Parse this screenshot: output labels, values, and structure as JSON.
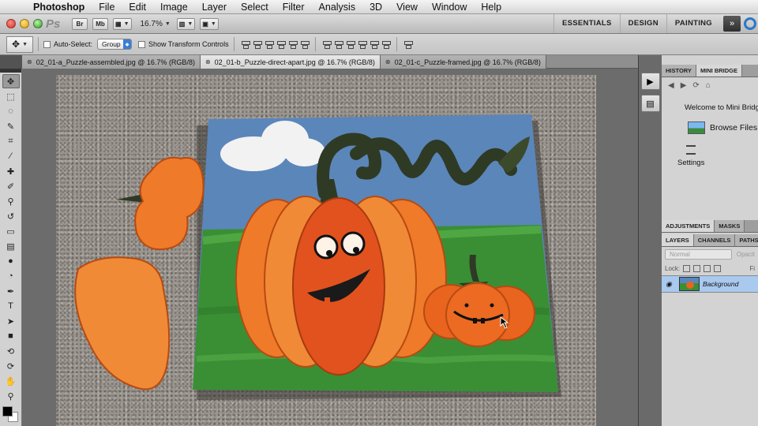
{
  "menubar": {
    "app_name": "Photoshop",
    "items": [
      "File",
      "Edit",
      "Image",
      "Layer",
      "Select",
      "Filter",
      "Analysis",
      "3D",
      "View",
      "Window",
      "Help"
    ]
  },
  "appbar": {
    "ps_logo": "Ps",
    "bridge_btn": "Br",
    "minibridge_btn": "Mb",
    "zoom": "16.7%",
    "workspaces": [
      "ESSENTIALS",
      "DESIGN",
      "PAINTING"
    ],
    "more_label": "»"
  },
  "options": {
    "auto_select_label": "Auto-Select:",
    "auto_select_value": "Group",
    "show_transform_label": "Show Transform Controls"
  },
  "tabs": [
    {
      "label": "02_01-a_Puzzle-assembled.jpg @ 16.7% (RGB/8)",
      "active": false
    },
    {
      "label": "02_01-b_Puzzle-direct-apart.jpg @ 16.7% (RGB/8)",
      "active": true
    },
    {
      "label": "02_01-c_Puzzle-framed.jpg @ 16.7% (RGB/8)",
      "active": false
    }
  ],
  "tools": [
    {
      "name": "move-tool-icon",
      "glyph": "✥",
      "active": true
    },
    {
      "name": "marquee-tool-icon",
      "glyph": "⬚"
    },
    {
      "name": "lasso-tool-icon",
      "glyph": "◌"
    },
    {
      "name": "quick-select-tool-icon",
      "glyph": "✎"
    },
    {
      "name": "crop-tool-icon",
      "glyph": "⌗"
    },
    {
      "name": "eyedropper-tool-icon",
      "glyph": "⁄"
    },
    {
      "name": "healing-brush-tool-icon",
      "glyph": "✚"
    },
    {
      "name": "brush-tool-icon",
      "glyph": "✐"
    },
    {
      "name": "clone-stamp-tool-icon",
      "glyph": "⚲"
    },
    {
      "name": "history-brush-tool-icon",
      "glyph": "↺"
    },
    {
      "name": "eraser-tool-icon",
      "glyph": "▭"
    },
    {
      "name": "gradient-tool-icon",
      "glyph": "▤"
    },
    {
      "name": "blur-tool-icon",
      "glyph": "●"
    },
    {
      "name": "dodge-tool-icon",
      "glyph": "◔"
    },
    {
      "name": "pen-tool-icon",
      "glyph": "✒"
    },
    {
      "name": "type-tool-icon",
      "glyph": "T"
    },
    {
      "name": "path-selection-tool-icon",
      "glyph": "➤"
    },
    {
      "name": "shape-tool-icon",
      "glyph": "■"
    },
    {
      "name": "3d-rotate-tool-icon",
      "glyph": "⟲"
    },
    {
      "name": "3d-orbit-tool-icon",
      "glyph": "⟳"
    },
    {
      "name": "hand-tool-icon",
      "glyph": "✋"
    },
    {
      "name": "zoom-tool-icon",
      "glyph": "⚲"
    }
  ],
  "panels": {
    "top_tabs": [
      "HISTORY",
      "MINI BRIDGE"
    ],
    "welcome": "Welcome to Mini Bridg",
    "browse": "Browse Files",
    "settings": "Settings",
    "adj_tabs": [
      "ADJUSTMENTS",
      "MASKS"
    ],
    "layer_tabs": [
      "LAYERS",
      "CHANNELS",
      "PATHS"
    ],
    "blend_mode": "Normal",
    "opacity_label": "Opacit",
    "lock_label": "Lock:",
    "fill_label": "Fi",
    "layer_name": "Background"
  },
  "colors": {
    "sky": "#5b86b9",
    "grass": "#3a8f35",
    "pumpkin": "#ef7a2a",
    "pumpkin_dark": "#e2521e",
    "stem": "#2f3a25"
  }
}
